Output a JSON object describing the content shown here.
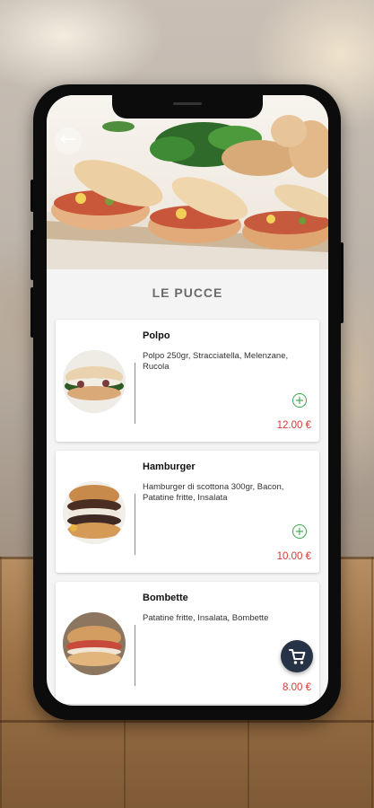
{
  "header": {
    "back_icon": "arrow-left-icon"
  },
  "section": {
    "title": "LE PUCCE"
  },
  "products": [
    {
      "name": "Polpo",
      "description": "Polpo 250gr, Stracciatella, Melenzane, Rucola",
      "price": "12.00 €"
    },
    {
      "name": "Hamburger",
      "description": "Hamburger di scottona 300gr, Bacon, Patatine fritte, Insalata",
      "price": "10.00 €"
    },
    {
      "name": "Bombette",
      "description": "Patatine fritte, Insalata, Bombette",
      "price": "8.00 €"
    }
  ],
  "add_icon": "plus-circle-icon",
  "cart": {
    "icon": "shopping-cart-icon"
  },
  "colors": {
    "price": "#d23b36",
    "add": "#3aa64a",
    "fab": "#263346"
  }
}
